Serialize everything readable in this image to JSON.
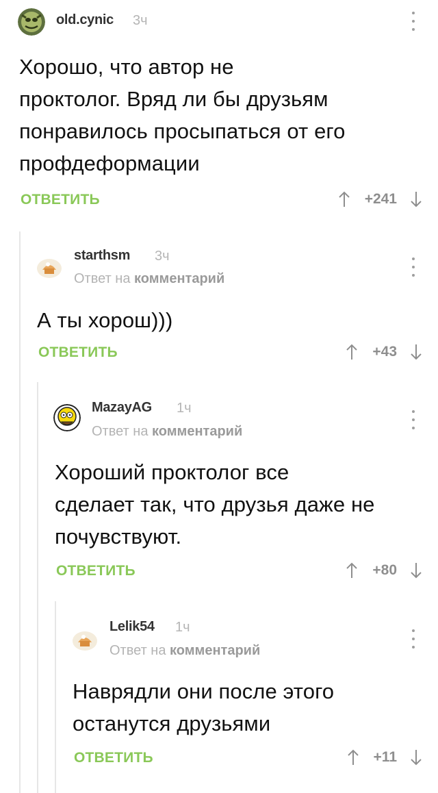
{
  "comments": [
    {
      "username": "old.cynic",
      "time": "3ч",
      "text_lines": [
        "Хорошо, что автор не",
        "проктолог. Вряд ли бы друзьям",
        "понравилось просыпаться от его",
        "профдеформации"
      ],
      "reply_label": "ОТВЕТИТЬ",
      "score": "+241"
    },
    {
      "username": "starthsm",
      "time": "3ч",
      "reply_prefix": "Ответ на",
      "reply_target": "комментарий",
      "text_lines": [
        "А ты хорош)))"
      ],
      "reply_label": "ОТВЕТИТЬ",
      "score": "+43"
    },
    {
      "username": "MazayAG",
      "time": "1ч",
      "reply_prefix": "Ответ на",
      "reply_target": "комментарий",
      "text_lines": [
        "Хороший проктолог все",
        "сделает так, что друзья даже не",
        "почувствуют."
      ],
      "reply_label": "ОТВЕТИТЬ",
      "score": "+80"
    },
    {
      "username": "Lelik54",
      "time": "1ч",
      "reply_prefix": "Ответ на",
      "reply_target": "комментарий",
      "text_lines": [
        "Наврядли они после этого",
        "останутся друзьями"
      ],
      "reply_label": "ОТВЕТИТЬ",
      "score": "+11"
    }
  ],
  "colors": {
    "accent_green": "#8ac858",
    "thread_line": "#e6e6e6",
    "muted": "#b3b3b3"
  },
  "icons": [
    "avatar-cynic-icon",
    "avatar-default-icon",
    "avatar-homer-icon",
    "more-vertical-icon",
    "arrow-up-icon",
    "arrow-down-icon"
  ]
}
